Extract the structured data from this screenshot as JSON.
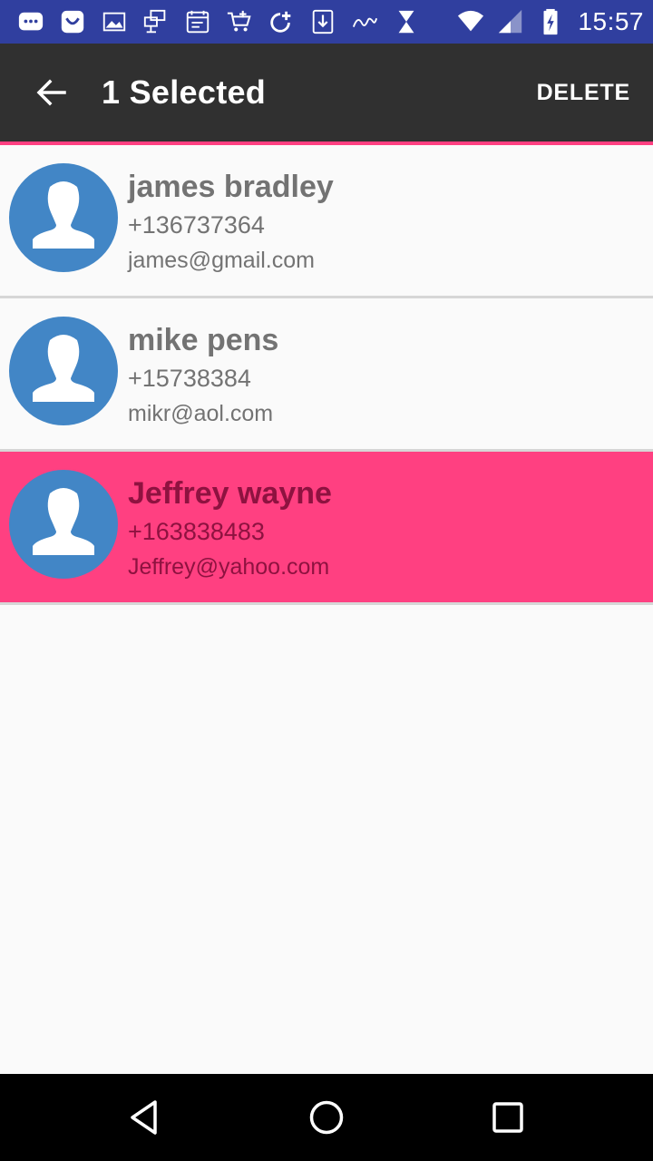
{
  "status_bar": {
    "time": "15:57",
    "left_icons": [
      "messaging-icon",
      "shopping-bag-icon",
      "image-icon",
      "network-icon",
      "calendar-icon",
      "cart-icon",
      "sync-plus-icon",
      "download-icon",
      "signature-icon",
      "hourglass-icon"
    ],
    "right_icons": [
      "wifi-icon",
      "signal-icon",
      "battery-charging-icon"
    ]
  },
  "action_bar": {
    "title": "1 Selected",
    "delete_label": "DELETE",
    "background": "#303030",
    "accent": "#ff4081"
  },
  "contacts": [
    {
      "name": "james bradley",
      "phone": "+136737364",
      "email": "james@gmail.com",
      "selected": false
    },
    {
      "name": "mike pens",
      "phone": "+15738384",
      "email": "mikr@aol.com",
      "selected": false
    },
    {
      "name": "Jeffrey wayne",
      "phone": "+163838483",
      "email": "Jeffrey@yahoo.com",
      "selected": true
    }
  ],
  "colors": {
    "status_bar": "#303f9f",
    "selected_row": "#ff4081",
    "avatar_bg": "#4286c6"
  },
  "nav_bar": {
    "buttons": [
      "back-triangle-icon",
      "home-circle-icon",
      "recents-square-icon"
    ]
  }
}
